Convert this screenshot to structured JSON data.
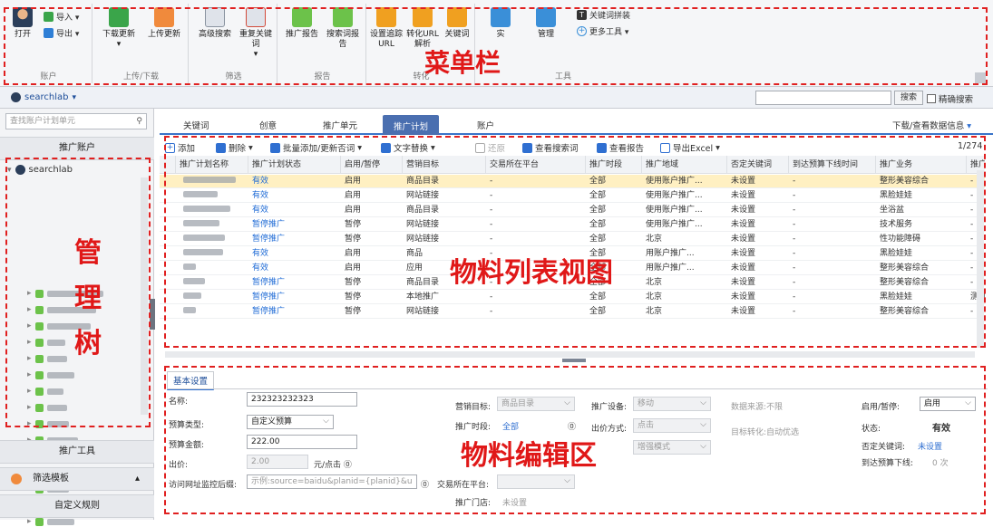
{
  "ribbon": {
    "groups": [
      {
        "label": "账户",
        "buttons": [
          {
            "label": "打开"
          }
        ],
        "small": [
          {
            "label": "导入 ▾"
          },
          {
            "label": "导出 ▾"
          }
        ]
      },
      {
        "label": "上传/下载",
        "buttons": [
          {
            "label": "下载更新"
          },
          {
            "label": "上传更新"
          }
        ]
      },
      {
        "label": "筛选",
        "buttons": [
          {
            "label": "高级搜索"
          },
          {
            "label": "重复关键词"
          }
        ]
      },
      {
        "label": "报告",
        "buttons": [
          {
            "label": "推广报告"
          },
          {
            "label": "搜索词报告"
          }
        ]
      },
      {
        "label": "转化",
        "buttons": [
          {
            "label": "设置追踪URL"
          },
          {
            "label": "转化URL解析"
          },
          {
            "label": "关键词"
          }
        ]
      },
      {
        "label": "工具",
        "buttons": [
          {
            "label": "实"
          },
          {
            "label": "管理"
          }
        ],
        "small": [
          {
            "label": "关键词拼装"
          },
          {
            "label": "更多工具 ▾"
          }
        ]
      }
    ]
  },
  "account_bar": {
    "account": "searchlab",
    "search_button": "搜索",
    "exact_search": "精确搜索"
  },
  "sidebar": {
    "search_placeholder": "查找账户计划单元",
    "header": "推广账户",
    "root": "searchlab",
    "bottom": [
      "推广工具",
      "筛选模板",
      "自定义规则"
    ]
  },
  "main": {
    "tabs": [
      "关键词",
      "创意",
      "推广单元",
      "推广计划",
      "账户"
    ],
    "active_tab": "推广计划",
    "download_info": "下载/查看数据信息",
    "toolbar": [
      "添加",
      "删除",
      "批量添加/更新否词",
      "文字替换",
      "还原",
      "查看搜索词",
      "查看报告",
      "导出Excel"
    ],
    "page_info": "1/274",
    "grid_headers": [
      "推广计划名称",
      "推广计划状态",
      "启用/暂停",
      "营销目标",
      "交易所在平台",
      "推广时段",
      "推广地域",
      "否定关键词",
      "到达预算下线时间",
      "推广业务",
      "推广门店"
    ],
    "rows": [
      {
        "status": "有效",
        "enable": "启用",
        "goal": "商品目录",
        "platform": "-",
        "time": "全部",
        "region": "使用账户推广...",
        "neg": "未设置",
        "budget": "-",
        "biz": "整形美容综合",
        "store": "-"
      },
      {
        "status": "有效",
        "enable": "启用",
        "goal": "网站链接",
        "platform": "-",
        "time": "全部",
        "region": "使用账户推广...",
        "neg": "未设置",
        "budget": "-",
        "biz": "黑脸娃娃",
        "store": "-"
      },
      {
        "status": "有效",
        "enable": "启用",
        "goal": "商品目录",
        "platform": "-",
        "time": "全部",
        "region": "使用账户推广...",
        "neg": "未设置",
        "budget": "-",
        "biz": "坐浴盆",
        "store": "-"
      },
      {
        "status": "暂停推广",
        "enable": "暂停",
        "goal": "网站链接",
        "platform": "-",
        "time": "全部",
        "region": "使用账户推广...",
        "neg": "未设置",
        "budget": "-",
        "biz": "技术服务",
        "store": "-"
      },
      {
        "status": "暂停推广",
        "enable": "暂停",
        "goal": "网站链接",
        "platform": "-",
        "time": "全部",
        "region": "北京",
        "neg": "未设置",
        "budget": "-",
        "biz": "性功能障碍",
        "store": "-"
      },
      {
        "status": "有效",
        "enable": "启用",
        "goal": "商品",
        "platform": "-",
        "time": "全部",
        "region": "用账户推广...",
        "neg": "未设置",
        "budget": "-",
        "biz": "黑脸娃娃",
        "store": "-"
      },
      {
        "status": "有效",
        "enable": "启用",
        "goal": "应用",
        "platform": "-",
        "time": "全部",
        "region": "用账户推广...",
        "neg": "未设置",
        "budget": "-",
        "biz": "整形美容综合",
        "store": "-"
      },
      {
        "status": "暂停推广",
        "enable": "暂停",
        "goal": "商品目录",
        "platform": "-",
        "time": "全部",
        "region": "北京",
        "neg": "未设置",
        "budget": "-",
        "biz": "整形美容综合",
        "store": "-"
      },
      {
        "status": "暂停推广",
        "enable": "暂停",
        "goal": "本地推广",
        "platform": "-",
        "time": "全部",
        "region": "北京",
        "neg": "未设置",
        "budget": "-",
        "biz": "黑脸娃娃",
        "store": "测试店铺"
      },
      {
        "status": "暂停推广",
        "enable": "暂停",
        "goal": "网站链接",
        "platform": "-",
        "time": "全部",
        "region": "北京",
        "neg": "未设置",
        "budget": "-",
        "biz": "整形美容综合",
        "store": "-"
      }
    ]
  },
  "editor": {
    "tab": "基本设置",
    "name_label": "名称:",
    "name_value": "232323232323",
    "budget_type_label": "预算类型:",
    "budget_type_value": "自定义预算",
    "budget_amount_label": "预算金额:",
    "budget_amount_value": "222.00",
    "bid_label": "出价:",
    "bid_value": "2.00",
    "bid_unit": "元/点击",
    "monitor_label": "访问网址监控后缀:",
    "monitor_value": "示例:source=baidu&planid={planid}&u",
    "goal_label": "营销目标:",
    "goal_value": "商品目录",
    "time_label": "推广时段:",
    "time_value": "全部",
    "platform_label": "交易所在平台:",
    "store_label": "推广门店:",
    "store_value": "未设置",
    "device_label": "推广设备:",
    "device_value": "移动",
    "bidmode_label": "出价方式:",
    "bidmode_value": "点击",
    "enhance_value": "增强模式",
    "source_label": "数据来源:",
    "source_value": "不限",
    "convert_label": "目标转化:",
    "convert_value": "自动优选",
    "enable_label": "启用/暂停:",
    "enable_value": "启用",
    "state_label": "状态:",
    "state_value": "有效",
    "neg_label": "否定关键词:",
    "neg_value": "未设置",
    "budget_off_label": "到达预算下线:",
    "budget_off_value": "0 次"
  },
  "annotations": {
    "menu": "菜单栏",
    "tree": [
      "管",
      "理",
      "树"
    ],
    "list": "物料列表视图",
    "edit": "物料编辑区"
  },
  "colors": {
    "annotation": "#e02020",
    "selected_row": "#fff0c2",
    "active_tab": "#4a6fb0",
    "link": "#1f6bd6"
  }
}
